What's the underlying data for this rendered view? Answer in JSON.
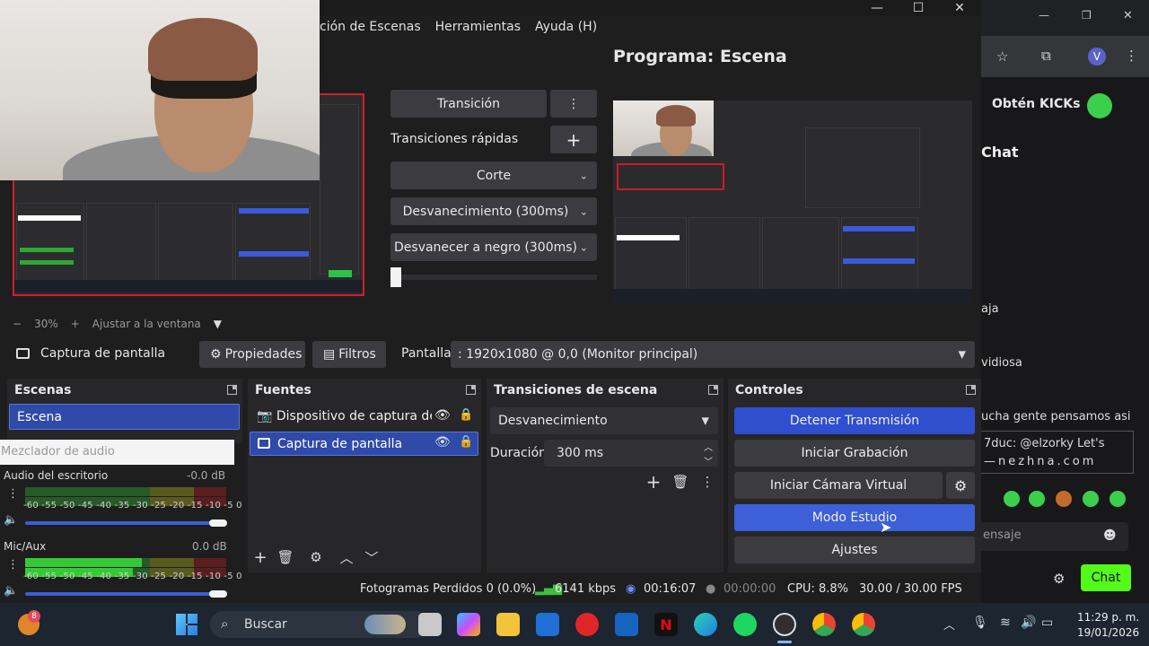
{
  "obs": {
    "menu": [
      "ción de Escenas",
      "Herramientas",
      "Ayuda (H)"
    ],
    "program_title": "Programa: Escena",
    "preview_controls": {
      "minus": "−",
      "zoom": "30%",
      "plus": "+",
      "fit": "Ajustar a la ventana"
    },
    "transition_panel": {
      "transition_button": "Transición",
      "quick_label": "Transiciones rápidas",
      "quick_items": [
        "Corte",
        "Desvanecimiento (300ms)",
        "Desvanecer a negro (300ms)"
      ]
    },
    "source_toolbar": {
      "source_name": "Captura de pantalla",
      "properties": "Propiedades",
      "filters": "Filtros",
      "screen_label": "Pantalla",
      "screen_value": ": 1920x1080 @ 0,0 (Monitor principal)"
    },
    "scenes": {
      "title": "Escenas",
      "items": [
        "Escena"
      ]
    },
    "sources": {
      "title": "Fuentes",
      "items": [
        "Dispositivo de captura de vic",
        "Captura de pantalla"
      ]
    },
    "scene_transitions": {
      "title": "Transiciones de escena",
      "selected": "Desvanecimiento",
      "duration_label": "Duración",
      "duration_value": "300 ms"
    },
    "controls": {
      "title": "Controles",
      "stop_stream": "Detener Transmisión",
      "start_recording": "Iniciar Grabación",
      "virtual_camera": "Iniciar Cámara Virtual",
      "studio_mode": "Modo Estudio",
      "settings": "Ajustes"
    },
    "audio_mixer": {
      "title": "Mezclador de audio",
      "channels": [
        {
          "name": "Audio del escritorio",
          "db": "-0.0 dB",
          "level": 0.0
        },
        {
          "name": "Mic/Aux",
          "db": "0.0 dB",
          "level": 0.6
        }
      ],
      "scale": "-60 -55 -50 -45 -40 -35 -30 -25 -20 -15 -10 -5 0"
    },
    "status": {
      "dropped": "Fotogramas Perdidos 0 (0.0%)",
      "bitrate": "6141 kbps",
      "stream_time": "00:16:07",
      "rec_time": "00:00:00",
      "cpu": "CPU: 8.8%",
      "fps": "30.00 / 30.00 FPS"
    }
  },
  "browser": {
    "kicks": "Obtén KICKs",
    "chat_header": "Chat",
    "messages": [
      "aja",
      "vidiosa",
      "ucha gente pensamos asi",
      "7duc: @elzorky Let's",
      "—nezhna.com"
    ],
    "input_placeholder": "ensaje",
    "chat_button": "Chat",
    "avatar_letter": "V"
  },
  "taskbar": {
    "search": "Buscar",
    "badge": "8",
    "time": "11:29 p. m.",
    "date": "19/01/2026"
  }
}
